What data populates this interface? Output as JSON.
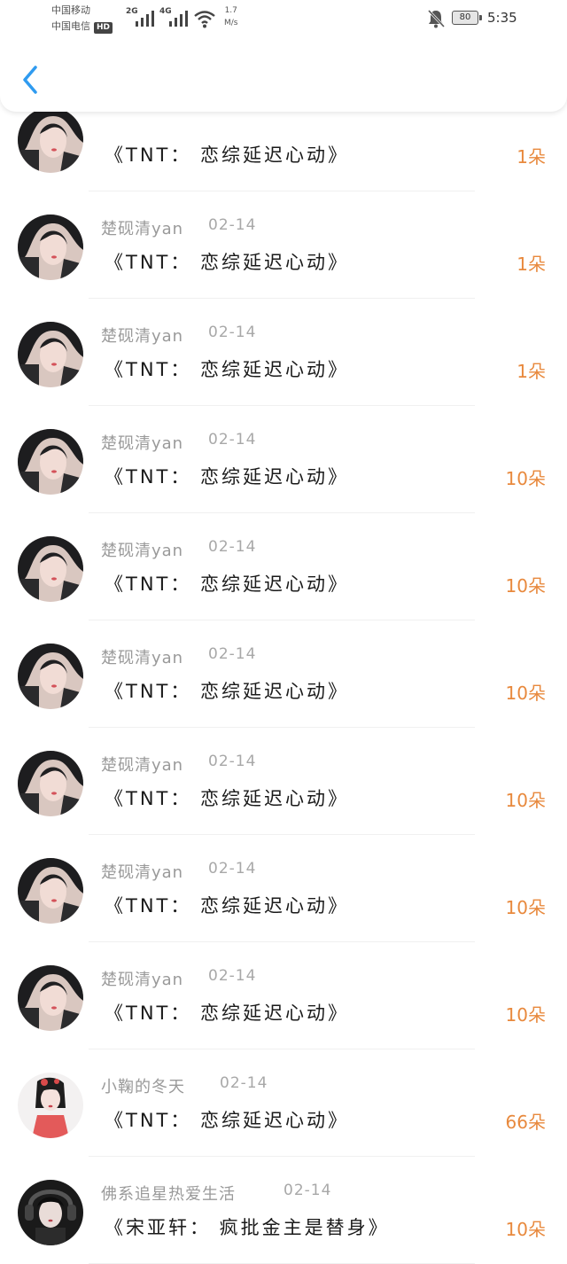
{
  "status_bar": {
    "carrier_1": "中国移动",
    "carrier_2": "中国电信",
    "hd_badge": "HD",
    "net_1": "2G",
    "net_2": "4G",
    "speed_value": "1.7",
    "speed_unit": "M/s",
    "battery": "80",
    "time": "5:35"
  },
  "header": {
    "back_icon": "chevron-left-icon",
    "accent": "#2f9bf0"
  },
  "colors": {
    "amount": "#e8893d",
    "username": "#9a9a9a"
  },
  "gifts": [
    {
      "avatar": "dark-hair-girl",
      "user": "",
      "date": "",
      "item": "《TNT：  恋综延迟心动》",
      "amount": "1朵"
    },
    {
      "avatar": "dark-hair-girl",
      "user": "楚砚清yan",
      "date": "02-14",
      "item": "《TNT：  恋综延迟心动》",
      "amount": "1朵"
    },
    {
      "avatar": "dark-hair-girl",
      "user": "楚砚清yan",
      "date": "02-14",
      "item": "《TNT：  恋综延迟心动》",
      "amount": "1朵"
    },
    {
      "avatar": "dark-hair-girl",
      "user": "楚砚清yan",
      "date": "02-14",
      "item": "《TNT：  恋综延迟心动》",
      "amount": "10朵"
    },
    {
      "avatar": "dark-hair-girl",
      "user": "楚砚清yan",
      "date": "02-14",
      "item": "《TNT：  恋综延迟心动》",
      "amount": "10朵"
    },
    {
      "avatar": "dark-hair-girl",
      "user": "楚砚清yan",
      "date": "02-14",
      "item": "《TNT：  恋综延迟心动》",
      "amount": "10朵"
    },
    {
      "avatar": "dark-hair-girl",
      "user": "楚砚清yan",
      "date": "02-14",
      "item": "《TNT：  恋综延迟心动》",
      "amount": "10朵"
    },
    {
      "avatar": "dark-hair-girl",
      "user": "楚砚清yan",
      "date": "02-14",
      "item": "《TNT：  恋综延迟心动》",
      "amount": "10朵"
    },
    {
      "avatar": "dark-hair-girl",
      "user": "楚砚清yan",
      "date": "02-14",
      "item": "《TNT：  恋综延迟心动》",
      "amount": "10朵"
    },
    {
      "avatar": "hanfu-girl",
      "user": "小鞠的冬天",
      "date": "02-14",
      "item": "《TNT：  恋综延迟心动》",
      "amount": "66朵"
    },
    {
      "avatar": "headphone-girl",
      "user": "佛系追星热爱生活",
      "date": "02-14",
      "item": "《宋亚轩：  疯批金主是替身》",
      "amount": "10朵"
    }
  ]
}
